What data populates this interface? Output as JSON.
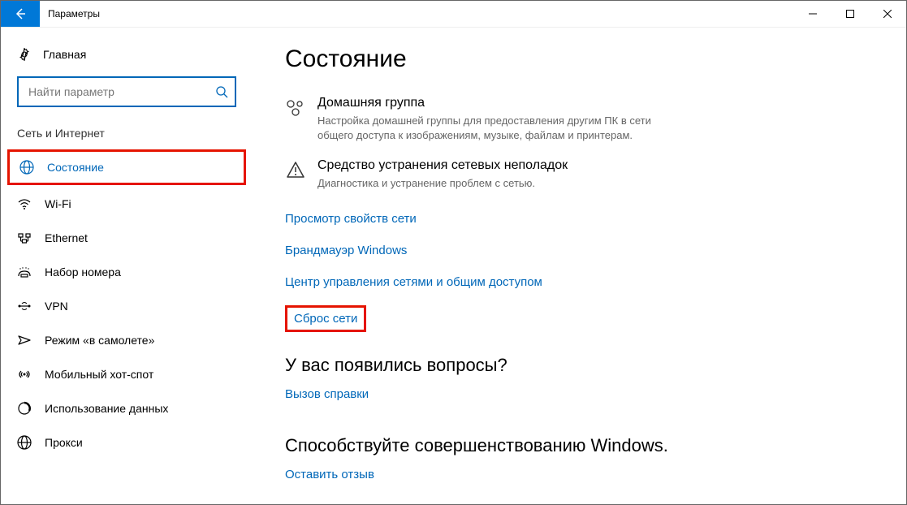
{
  "window": {
    "title": "Параметры"
  },
  "sidebar": {
    "home": "Главная",
    "search_placeholder": "Найти параметр",
    "section": "Сеть и Интернет",
    "items": [
      {
        "label": "Состояние"
      },
      {
        "label": "Wi-Fi"
      },
      {
        "label": "Ethernet"
      },
      {
        "label": "Набор номера"
      },
      {
        "label": "VPN"
      },
      {
        "label": "Режим «в самолете»"
      },
      {
        "label": "Мобильный хот-спот"
      },
      {
        "label": "Использование данных"
      },
      {
        "label": "Прокси"
      }
    ]
  },
  "main": {
    "heading": "Состояние",
    "homegroup_title": "Домашняя группа",
    "homegroup_desc": "Настройка домашней группы для предоставления другим ПК в сети общего доступа к изображениям, музыке, файлам и принтерам.",
    "troubleshoot_title": "Средство устранения сетевых неполадок",
    "troubleshoot_desc": "Диагностика и устранение проблем с сетью.",
    "links": {
      "view_props": "Просмотр свойств сети",
      "firewall": "Брандмауэр Windows",
      "sharing_center": "Центр управления сетями и общим доступом",
      "reset": "Сброс сети"
    },
    "questions_heading": "У вас появились вопросы?",
    "help_link": "Вызов справки",
    "improve_heading": "Способствуйте совершенствованию Windows.",
    "feedback_link": "Оставить отзыв"
  }
}
